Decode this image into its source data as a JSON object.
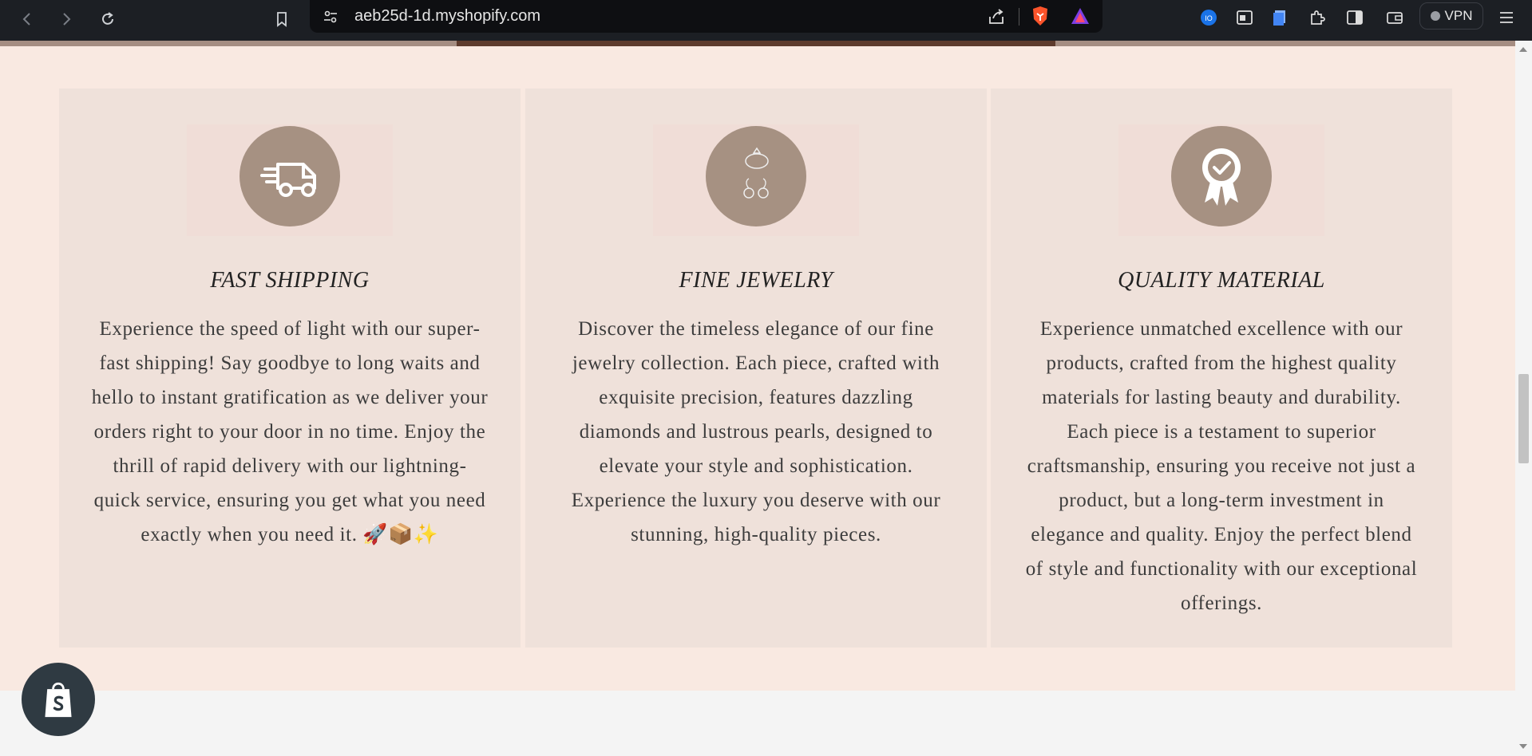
{
  "browser": {
    "url": "aeb25d-1d.myshopify.com",
    "vpn_label": "VPN"
  },
  "features": [
    {
      "title": "FAST SHIPPING",
      "icon": "truck-icon",
      "text": "Experience the speed of light with our super-fast shipping! Say goodbye to long waits and hello to instant gratification as we deliver your orders right to your door in no time. Enjoy the thrill of rapid delivery with our lightning-quick service, ensuring you get what you need exactly when you need it. 🚀📦✨"
    },
    {
      "title": "FINE JEWELRY",
      "icon": "ring-earrings-icon",
      "text": "Discover the timeless elegance of our fine jewelry collection. Each piece, crafted with exquisite precision, features dazzling diamonds and lustrous pearls, designed to elevate your style and sophistication. Experience the luxury you deserve with our stunning, high-quality pieces."
    },
    {
      "title": "QUALITY MATERIAL",
      "icon": "award-ribbon-icon",
      "text": "Experience unmatched excellence with our products, crafted from the highest quality materials for lasting beauty and durability. Each piece is a testament to superior craftsmanship, ensuring you receive not just a product, but a long-term investment in elegance and quality. Enjoy the perfect blend of style and functionality with our exceptional offerings."
    }
  ],
  "colors": {
    "section_bg": "#f9e9e1",
    "card_bg": "#efe1da",
    "icon_circle": "#a69182"
  }
}
